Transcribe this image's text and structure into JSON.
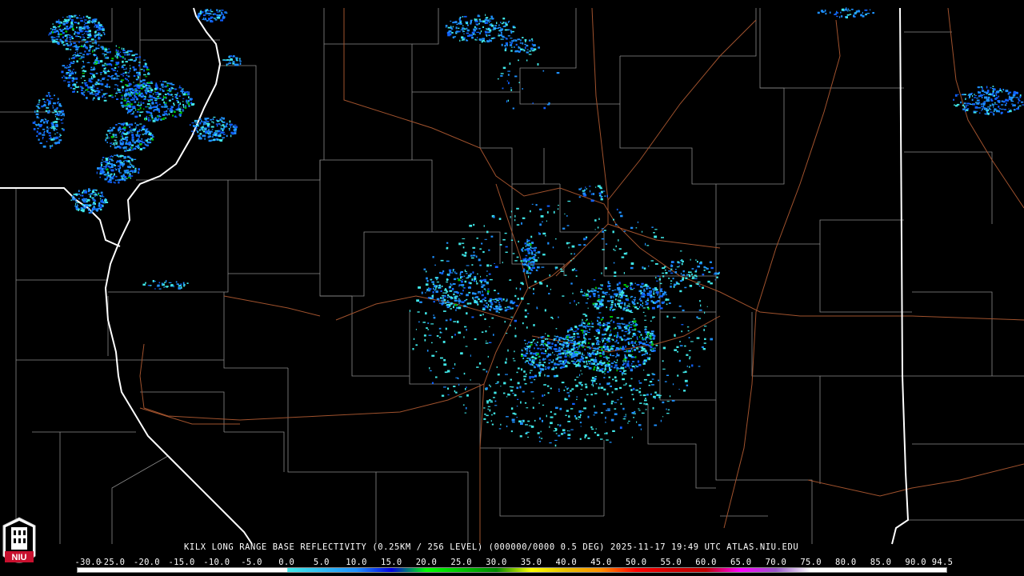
{
  "caption": {
    "station": "KILX",
    "text": "KILX LONG RANGE BASE REFLECTIVITY (0.25KM / 256 LEVEL) (000000/0000 0.5 DEG) 2025-11-17 19:49 UTC  ATLAS.NIU.EDU"
  },
  "logo": {
    "text": "NIU"
  },
  "scale": {
    "labels": [
      "-30.0",
      "-25.0",
      "-20.0",
      "-15.0",
      "-10.0",
      "-5.0",
      "0.0",
      "5.0",
      "10.0",
      "15.0",
      "20.0",
      "25.0",
      "30.0",
      "35.0",
      "40.0",
      "45.0",
      "50.0",
      "55.0",
      "60.0",
      "65.0",
      "70.0",
      "75.0",
      "80.0",
      "85.0",
      "90.0",
      "94.5"
    ],
    "min": -30.0,
    "max": 94.5,
    "stops": [
      {
        "v": -30,
        "c": "#ffffff"
      },
      {
        "v": 0,
        "c": "#ffffff"
      },
      {
        "v": 0.1,
        "c": "#40e8e8"
      },
      {
        "v": 10,
        "c": "#1e90ff"
      },
      {
        "v": 15,
        "c": "#0000e0"
      },
      {
        "v": 20,
        "c": "#00ff00"
      },
      {
        "v": 30,
        "c": "#008800"
      },
      {
        "v": 35,
        "c": "#ffff00"
      },
      {
        "v": 40,
        "c": "#e8c000"
      },
      {
        "v": 45,
        "c": "#ff9000"
      },
      {
        "v": 50,
        "c": "#ff0000"
      },
      {
        "v": 55,
        "c": "#d40000"
      },
      {
        "v": 60,
        "c": "#c00000"
      },
      {
        "v": 65,
        "c": "#ff00ff"
      },
      {
        "v": 70,
        "c": "#9955c9"
      },
      {
        "v": 75,
        "c": "#ffffff"
      },
      {
        "v": 94.5,
        "c": "#ffffff"
      }
    ]
  },
  "colors": {
    "background": "#000000",
    "county_lines": "#8a8a8a",
    "state_lines": "#ffffff",
    "roads": "#a0522d",
    "echo_light": "#40e8e8",
    "echo_mid": "#1e90ff",
    "echo_strong": "#00c000"
  }
}
